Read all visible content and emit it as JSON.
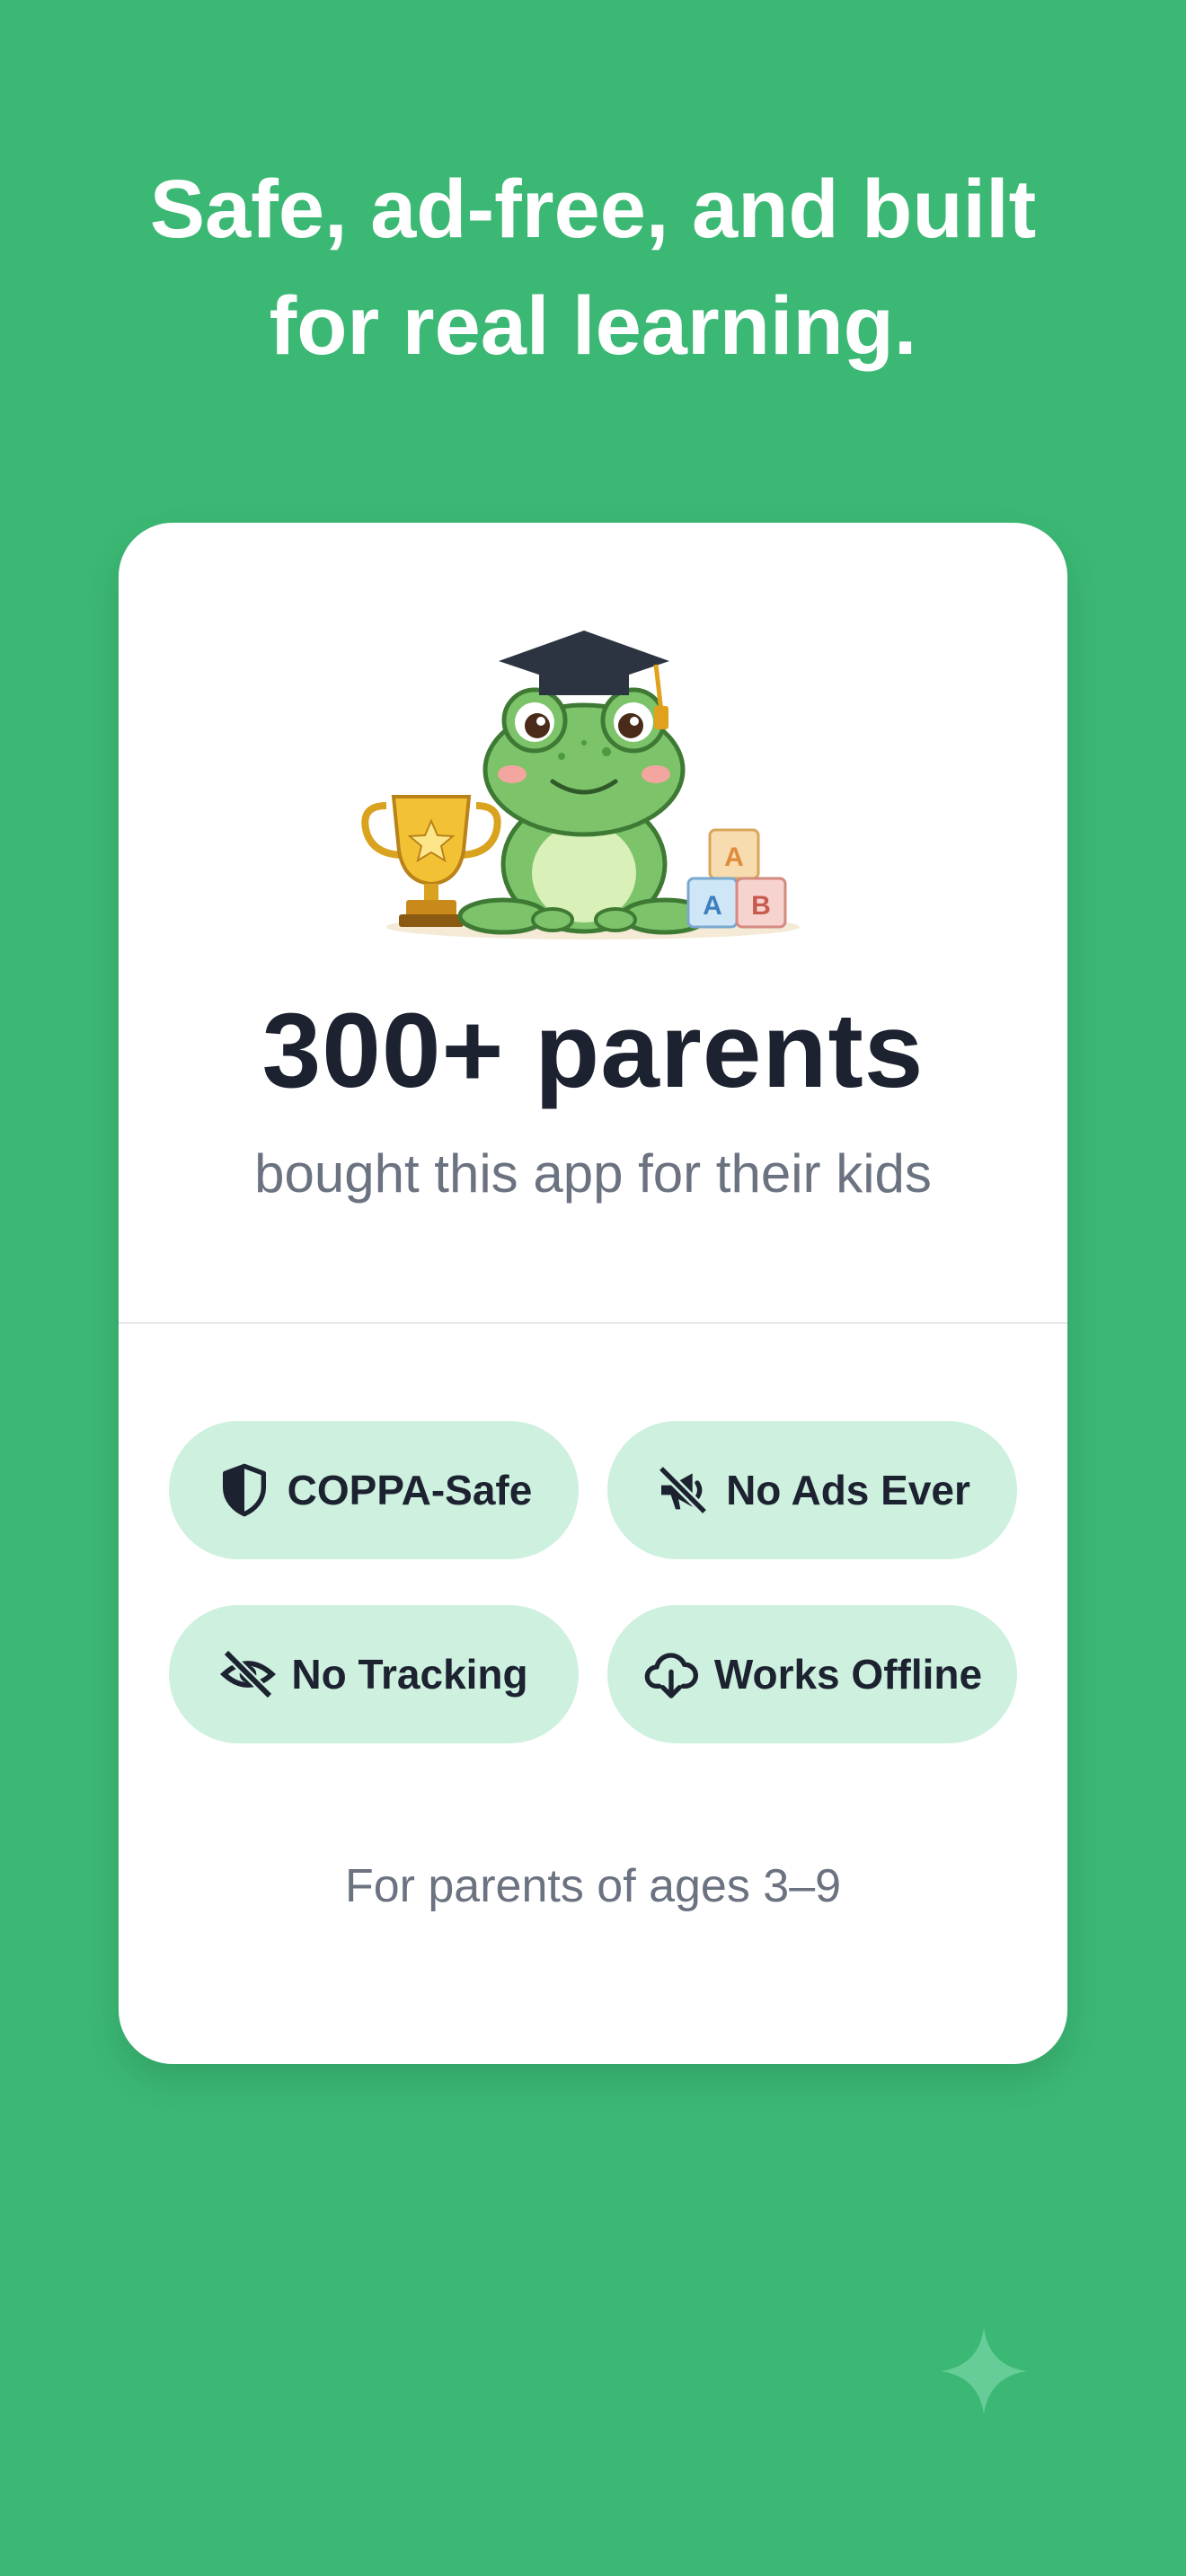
{
  "headline": {
    "line1": "Safe, ad-free, and built",
    "line2": "for real learning."
  },
  "card": {
    "illustration": "frog-graduate-with-trophy-and-blocks",
    "count": "300+ parents",
    "subtitle": "bought this app for their kids",
    "badges": [
      {
        "icon": "shield-icon",
        "label": "COPPA-Safe"
      },
      {
        "icon": "megaphone-off-icon",
        "label": "No Ads Ever"
      },
      {
        "icon": "eye-off-icon",
        "label": "No Tracking"
      },
      {
        "icon": "cloud-download-icon",
        "label": "Works Offline"
      }
    ],
    "ages_note": "For parents of ages 3–9"
  },
  "colors": {
    "background": "#3bb874",
    "badge_bg": "#cdf0df",
    "text_dark": "#1d2230",
    "text_muted": "#6b7280"
  }
}
